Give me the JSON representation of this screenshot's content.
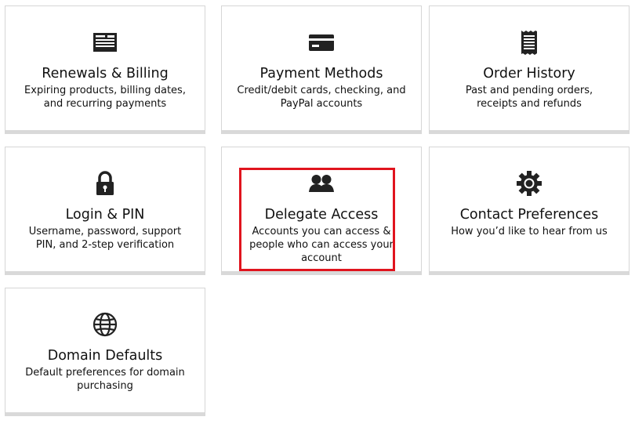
{
  "cards": [
    {
      "icon": "billing-document-icon",
      "title": "Renewals & Billing",
      "desc": "Expiring products, billing dates, and recurring payments"
    },
    {
      "icon": "credit-card-icon",
      "title": "Payment Methods",
      "desc": "Credit/debit cards, checking, and PayPal accounts"
    },
    {
      "icon": "receipt-icon",
      "title": "Order History",
      "desc": "Past and pending orders, receipts and refunds"
    },
    {
      "icon": "padlock-icon",
      "title": "Login & PIN",
      "desc": "Username, password, support PIN, and 2-step verification"
    },
    {
      "icon": "two-people-icon",
      "title": "Delegate Access",
      "desc": "Accounts you can access & people who can access your account"
    },
    {
      "icon": "gear-icon",
      "title": "Contact Preferences",
      "desc": "How you’d like to hear from us"
    },
    {
      "icon": "globe-icon",
      "title": "Domain Defaults",
      "desc": "Default preferences for domain purchasing"
    }
  ],
  "colors": {
    "highlight": "#e0141e",
    "card_border": "#d6d6d6",
    "icon": "#222222"
  }
}
